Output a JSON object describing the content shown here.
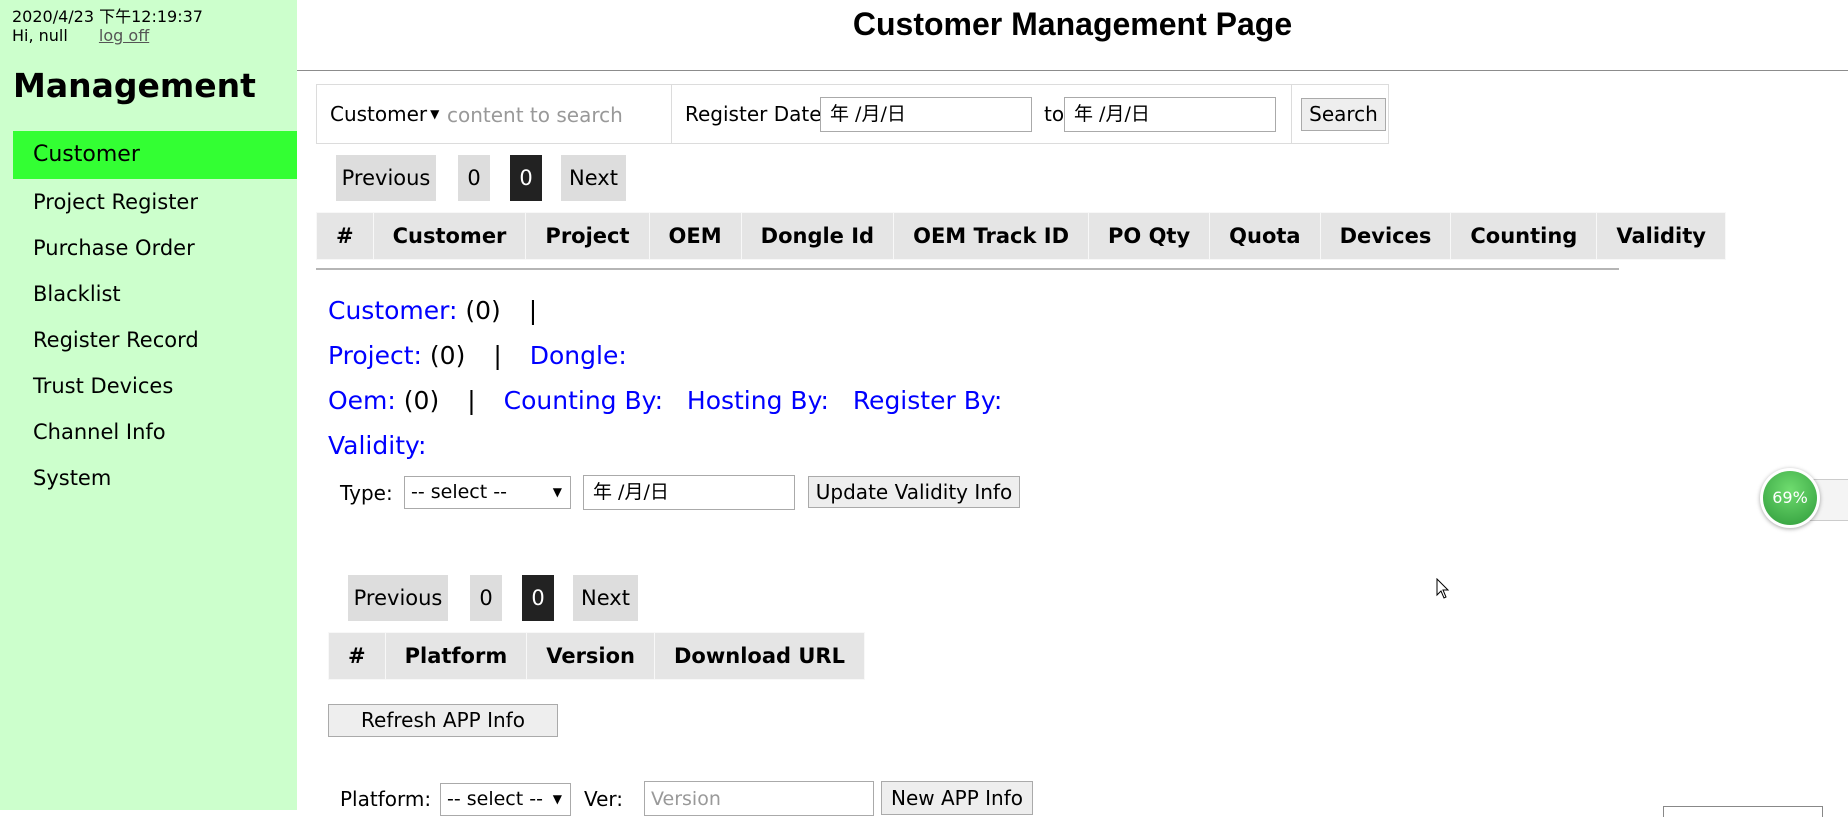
{
  "sidebar": {
    "datetime": "2020/4/23  下午12:19:37",
    "greeting": "Hi, null",
    "logoff": "log off",
    "title": "Management",
    "items": [
      {
        "label": "Customer",
        "active": true
      },
      {
        "label": "Project Register"
      },
      {
        "label": "Purchase Order"
      },
      {
        "label": "Blacklist"
      },
      {
        "label": "Register Record"
      },
      {
        "label": "Trust Devices"
      },
      {
        "label": "Channel Info"
      },
      {
        "label": "System"
      }
    ]
  },
  "header": {
    "title": "Customer Management Page"
  },
  "search": {
    "field": "Customer",
    "placeholder": "content to search",
    "date_label": "Register Date",
    "date_from": "年 /月/日",
    "to_label": "to",
    "date_to": "年 /月/日",
    "button": "Search"
  },
  "pager_top": {
    "prev": "Previous",
    "first": "0",
    "current": "0",
    "next": "Next"
  },
  "customer_table": {
    "columns": [
      "#",
      "Customer",
      "Project",
      "OEM",
      "Dongle Id",
      "OEM Track ID",
      "PO Qty",
      "Quota",
      "Devices",
      "Counting",
      "Validity"
    ]
  },
  "detail": {
    "customer_label": "Customer:",
    "customer_count": " (0)",
    "project_label": "Project:",
    "project_count": " (0)",
    "dongle_label": "Dongle:",
    "oem_label": "Oem:",
    "oem_count": " (0)",
    "counting_label": "Counting By:",
    "hosting_label": "Hosting By:",
    "register_label": "Register By:",
    "validity_label": "Validity:",
    "separator": "|"
  },
  "validity_form": {
    "type_label": "Type:",
    "type_select": "-- select --",
    "date": "年 /月/日",
    "update_button": "Update Validity Info"
  },
  "pager_bottom": {
    "prev": "Previous",
    "first": "0",
    "current": "0",
    "next": "Next"
  },
  "app_table": {
    "columns": [
      "#",
      "Platform",
      "Version",
      "Download URL"
    ]
  },
  "refresh_button": "Refresh APP Info",
  "app_form": {
    "platform_label": "Platform:",
    "platform_select": "-- select --",
    "ver_label": "Ver:",
    "ver_placeholder": "Version",
    "new_button": "New APP Info"
  },
  "widget": {
    "percent": "69%"
  },
  "colors": {
    "sidebar_bg": "#ccffcc",
    "active_nav": "#33ff33",
    "detail_label": "#0000ff",
    "current_page": "#222222"
  }
}
